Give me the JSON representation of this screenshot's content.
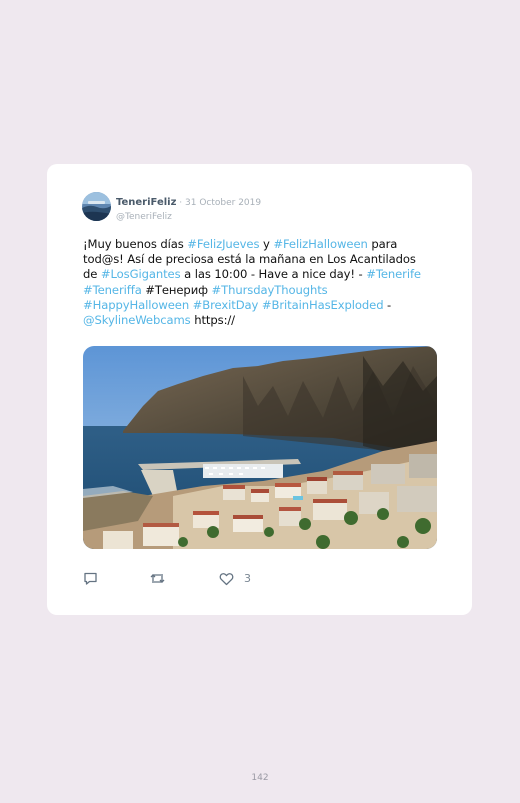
{
  "tweet": {
    "display_name": "TeneriFeliz",
    "date": " · 31 October 2019",
    "handle": "@TeneriFeliz",
    "text_lines": [
      [
        {
          "t": "¡Muy buenos días ",
          "tag": false
        },
        {
          "t": "#FelizJueves",
          "tag": true
        },
        {
          "t": " y ",
          "tag": false
        },
        {
          "t": "#FelizHalloween",
          "tag": true
        },
        {
          "t": " para",
          "tag": false
        }
      ],
      [
        {
          "t": "tod@s! Así de preciosa está la mañana en Los Acantilados",
          "tag": false
        }
      ],
      [
        {
          "t": "de ",
          "tag": false
        },
        {
          "t": "#LosGigantes",
          "tag": true
        },
        {
          "t": " a las 10:00 - Have a nice day! - ",
          "tag": false
        },
        {
          "t": "#Tenerife",
          "tag": true
        }
      ],
      [
        {
          "t": "#Teneriffa",
          "tag": true
        },
        {
          "t": " #Тенериф ",
          "tag": false
        },
        {
          "t": "#ThursdayThoughts",
          "tag": true
        }
      ],
      [
        {
          "t": "#HappyHalloween",
          "tag": true
        },
        {
          "t": " ",
          "tag": false
        },
        {
          "t": "#BrexitDay",
          "tag": true
        },
        {
          "t": " ",
          "tag": false
        },
        {
          "t": "#BritainHasExploded",
          "tag": true
        },
        {
          "t": " -",
          "tag": false
        }
      ],
      [
        {
          "t": "@SkylineWebcams",
          "tag": true
        },
        {
          "t": " https://",
          "tag": false
        }
      ]
    ],
    "like_count": "3"
  },
  "icons": {
    "reply": "reply-icon",
    "retweet": "retweet-icon",
    "like": "heart-icon"
  },
  "colors": {
    "background": "#efe8ef",
    "card": "#ffffff",
    "link": "#55b6e6",
    "muted": "#a8b0b8"
  },
  "page_number": "142"
}
